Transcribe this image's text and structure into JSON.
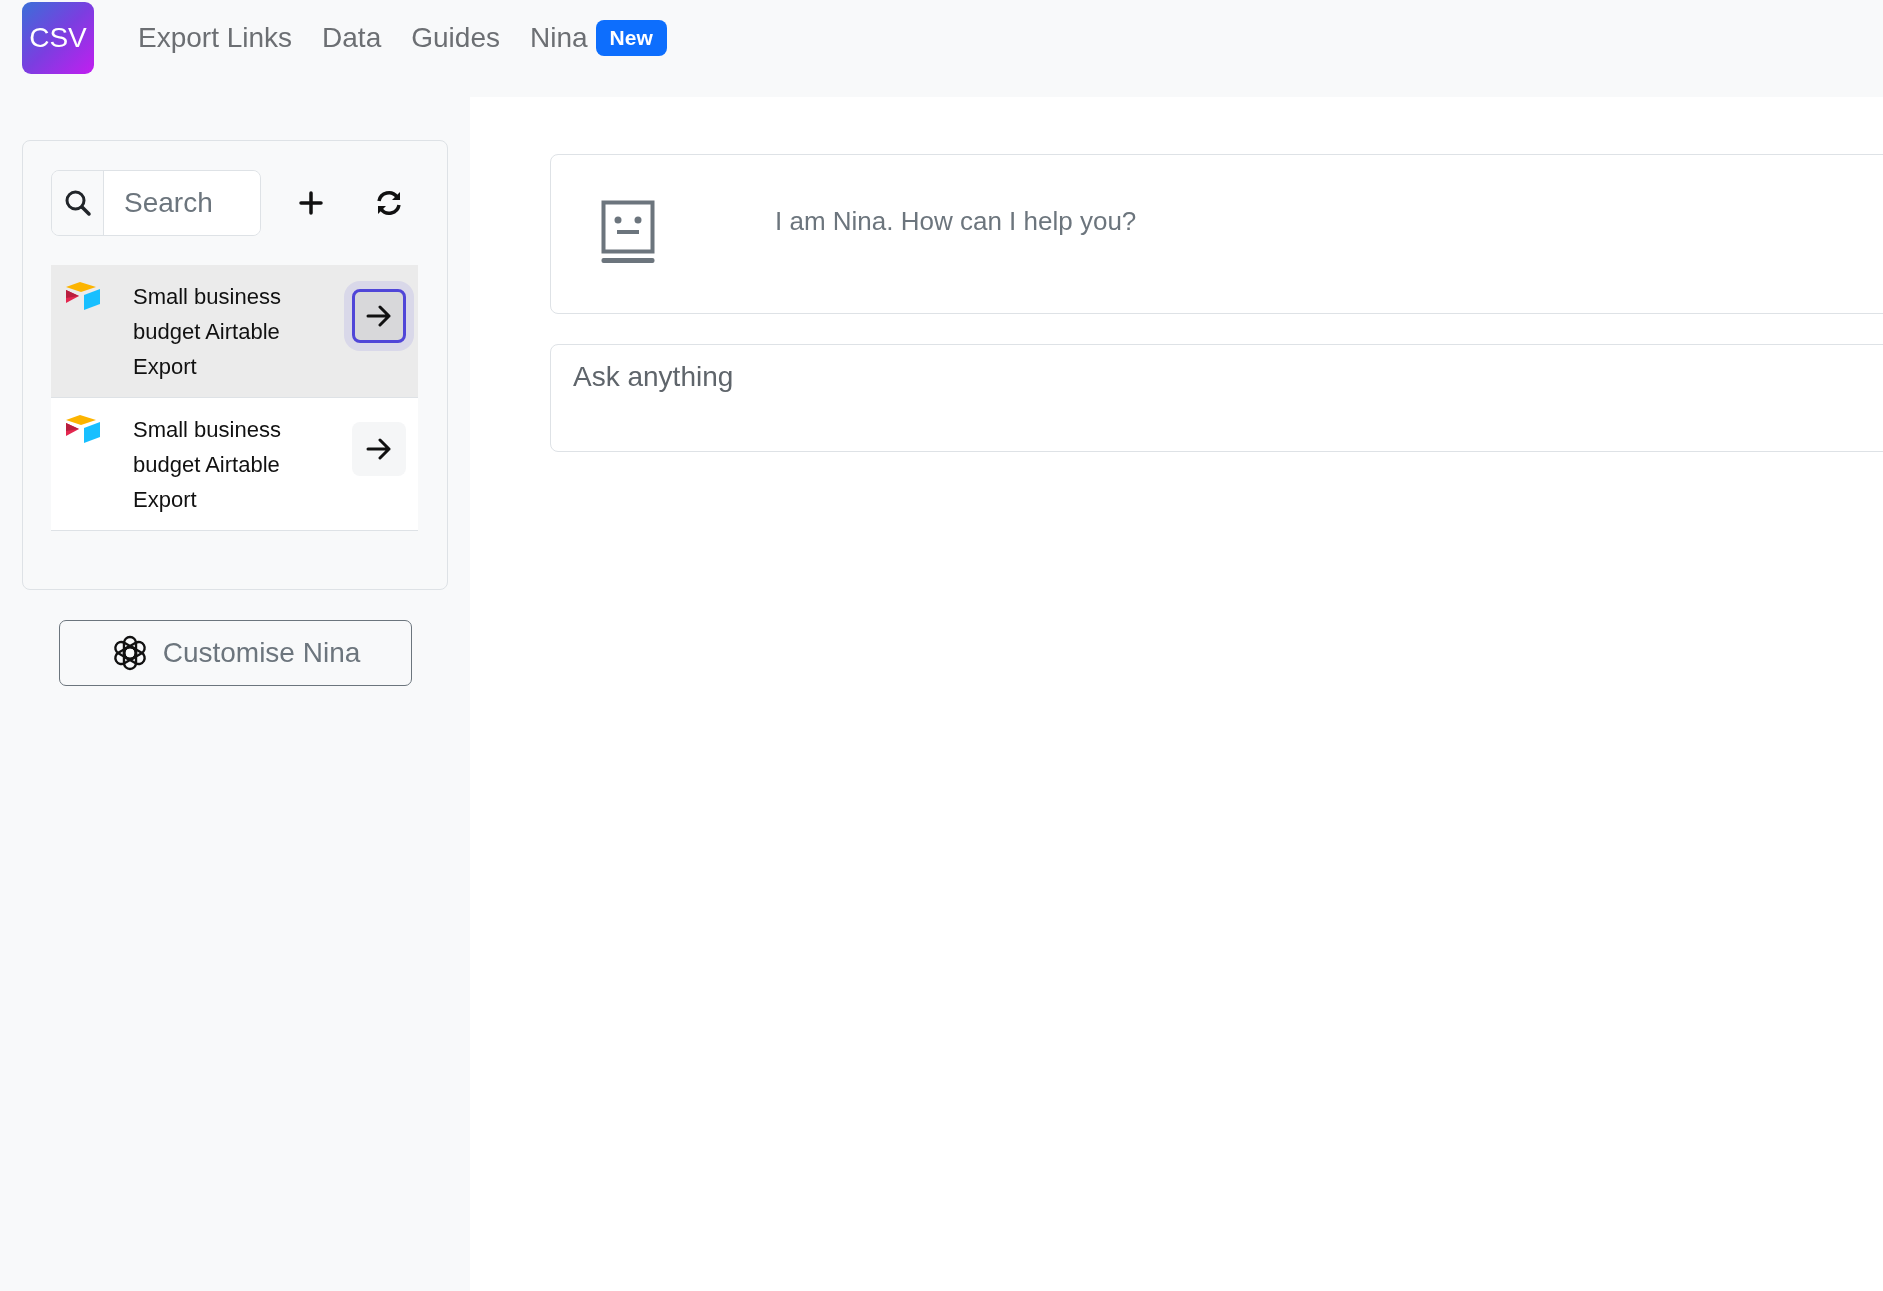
{
  "logo": "CSV",
  "nav": [
    {
      "label": "Export Links"
    },
    {
      "label": "Data"
    },
    {
      "label": "Guides"
    },
    {
      "label": "Nina",
      "badge": "New"
    }
  ],
  "search": {
    "placeholder": "Search"
  },
  "exports": [
    {
      "title": "Small business budget Airtable Export",
      "selected": true
    },
    {
      "title": "Small business budget Airtable Export",
      "selected": false
    }
  ],
  "customise_button": "Customise Nina",
  "chat": {
    "message": "I am Nina. How can I help you?",
    "input": {
      "placeholder": "Ask anything"
    }
  }
}
